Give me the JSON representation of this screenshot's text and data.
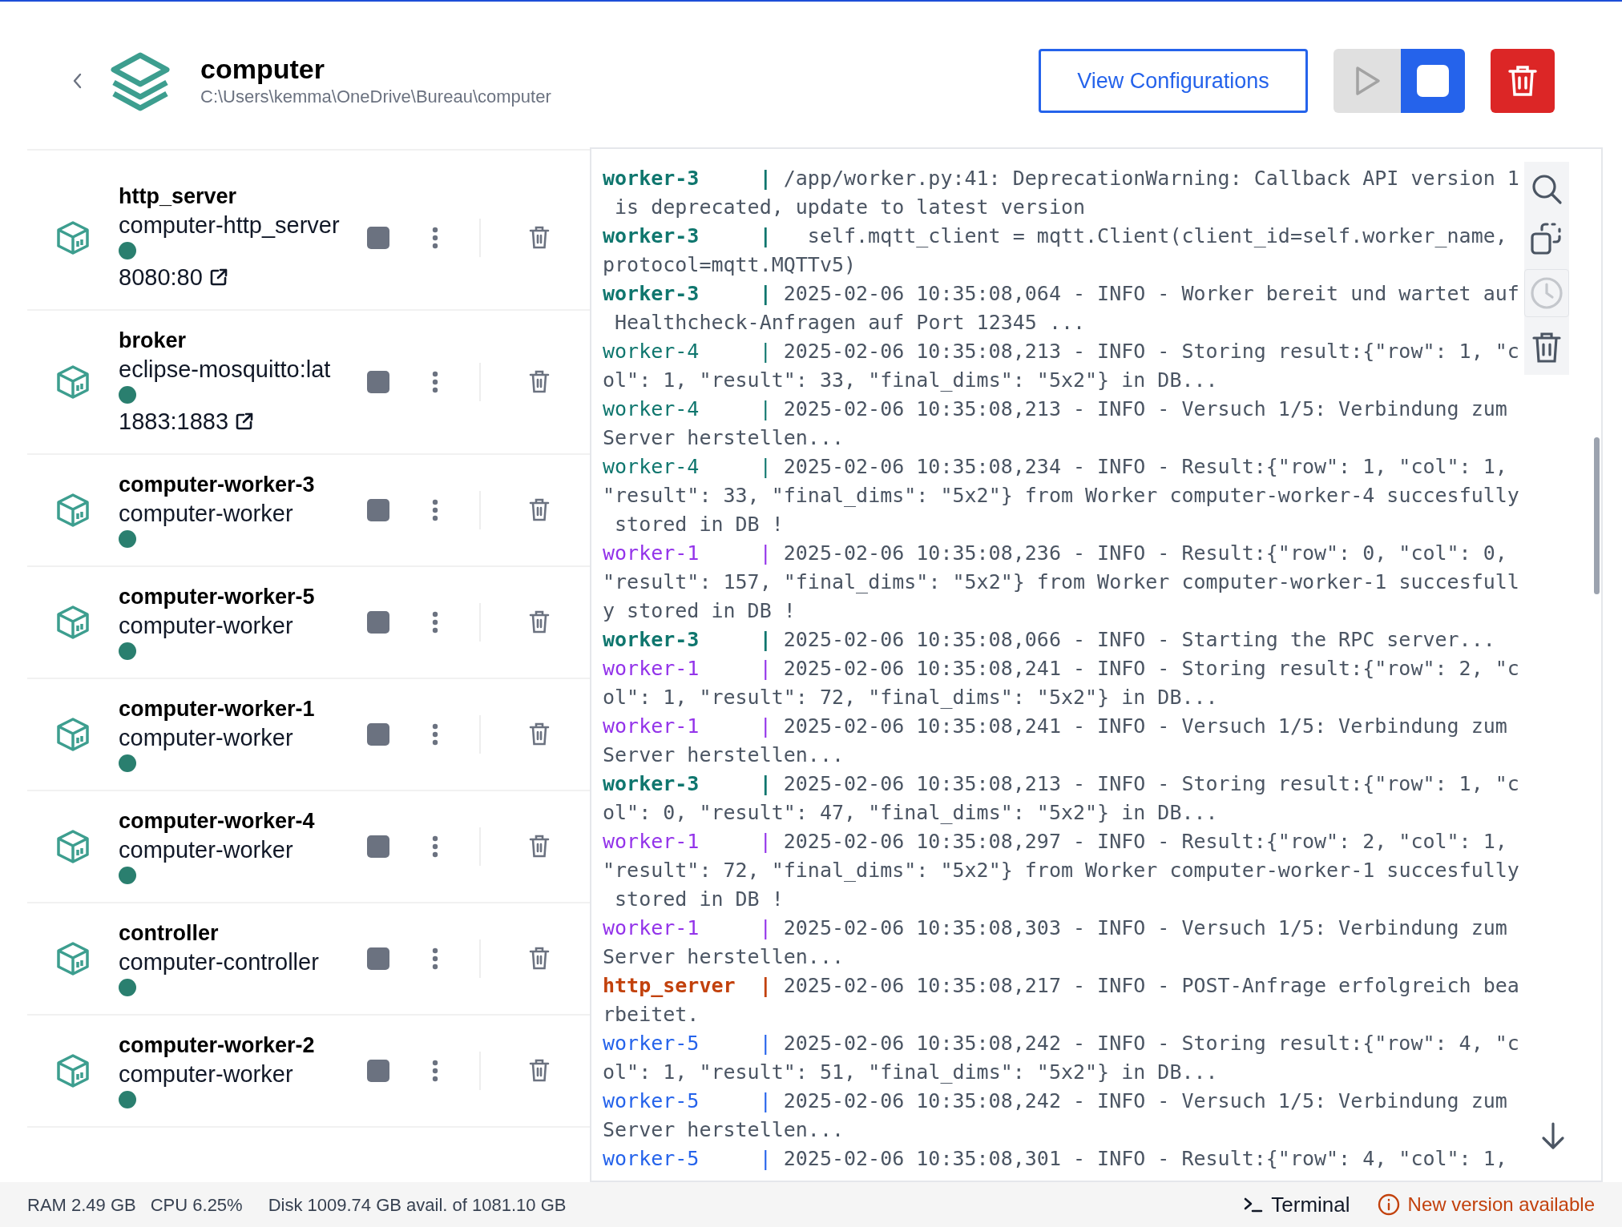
{
  "header": {
    "title": "computer",
    "path": "C:\\Users\\kemma\\OneDrive\\Bureau\\computer",
    "view_button": "View Configurations",
    "play_disabled": true,
    "stop_active": true
  },
  "services": [
    {
      "name": "http_server",
      "image": "computer-http_server",
      "running": true,
      "port": "8080:80"
    },
    {
      "name": "broker",
      "image": "eclipse-mosquitto:lat",
      "running": true,
      "port": "1883:1883"
    },
    {
      "name": "computer-worker-3",
      "image": "computer-worker",
      "running": true
    },
    {
      "name": "computer-worker-5",
      "image": "computer-worker",
      "running": true
    },
    {
      "name": "computer-worker-1",
      "image": "computer-worker",
      "running": true
    },
    {
      "name": "computer-worker-4",
      "image": "computer-worker",
      "running": true
    },
    {
      "name": "controller",
      "image": "computer-controller",
      "running": true
    },
    {
      "name": "computer-worker-2",
      "image": "computer-worker",
      "running": true
    }
  ],
  "log": {
    "clock_disabled": true,
    "entries": [
      {
        "service": "worker-3",
        "color": "#0f766e",
        "bold": true,
        "pipe": "|",
        "lines": [
          "/app/worker.py:41: DeprecationWarning: Callback API version 1",
          " is deprecated, update to latest version"
        ]
      },
      {
        "service": "worker-3",
        "color": "#0f766e",
        "bold": true,
        "pipe": "|",
        "lines": [
          "  self.mqtt_client = mqtt.Client(client_id=self.worker_name,",
          "protocol=mqtt.MQTTv5)"
        ]
      },
      {
        "service": "worker-3",
        "color": "#0f766e",
        "bold": true,
        "pipe": "|",
        "lines": [
          "2025-02-06 10:35:08,064 - INFO - Worker bereit und wartet auf",
          " Healthcheck-Anfragen auf Port 12345 ..."
        ]
      },
      {
        "service": "worker-4",
        "color": "#0f766e",
        "bold": false,
        "pipe": "|",
        "lines": [
          "2025-02-06 10:35:08,213 - INFO - Storing result:{\"row\": 1, \"c",
          "ol\": 1, \"result\": 33, \"final_dims\": \"5x2\"} in DB..."
        ]
      },
      {
        "service": "worker-4",
        "color": "#0f766e",
        "bold": false,
        "pipe": "|",
        "lines": [
          "2025-02-06 10:35:08,213 - INFO - Versuch 1/5: Verbindung zum",
          "Server herstellen..."
        ]
      },
      {
        "service": "worker-4",
        "color": "#0f766e",
        "bold": false,
        "pipe": "|",
        "lines": [
          "2025-02-06 10:35:08,234 - INFO - Result:{\"row\": 1, \"col\": 1,",
          "\"result\": 33, \"final_dims\": \"5x2\"} from Worker computer-worker-4 succesfully",
          " stored in DB !"
        ]
      },
      {
        "service": "worker-1",
        "color": "#9333ea",
        "bold": false,
        "pipe": "|",
        "lines": [
          "2025-02-06 10:35:08,236 - INFO - Result:{\"row\": 0, \"col\": 0,",
          "\"result\": 157, \"final_dims\": \"5x2\"} from Worker computer-worker-1 succesfull",
          "y stored in DB !"
        ]
      },
      {
        "service": "worker-3",
        "color": "#0f766e",
        "bold": true,
        "pipe": "|",
        "lines": [
          "2025-02-06 10:35:08,066 - INFO - Starting the RPC server..."
        ]
      },
      {
        "service": "worker-1",
        "color": "#9333ea",
        "bold": false,
        "pipe": "|",
        "lines": [
          "2025-02-06 10:35:08,241 - INFO - Storing result:{\"row\": 2, \"c",
          "ol\": 1, \"result\": 72, \"final_dims\": \"5x2\"} in DB..."
        ]
      },
      {
        "service": "worker-1",
        "color": "#9333ea",
        "bold": false,
        "pipe": "|",
        "lines": [
          "2025-02-06 10:35:08,241 - INFO - Versuch 1/5: Verbindung zum",
          "Server herstellen..."
        ]
      },
      {
        "service": "worker-3",
        "color": "#0f766e",
        "bold": true,
        "pipe": "|",
        "lines": [
          "2025-02-06 10:35:08,213 - INFO - Storing result:{\"row\": 1, \"c",
          "ol\": 0, \"result\": 47, \"final_dims\": \"5x2\"} in DB..."
        ]
      },
      {
        "service": "worker-1",
        "color": "#9333ea",
        "bold": false,
        "pipe": "|",
        "lines": [
          "2025-02-06 10:35:08,297 - INFO - Result:{\"row\": 2, \"col\": 1,",
          "\"result\": 72, \"final_dims\": \"5x2\"} from Worker computer-worker-1 succesfully",
          " stored in DB !"
        ]
      },
      {
        "service": "worker-1",
        "color": "#9333ea",
        "bold": false,
        "pipe": "|",
        "lines": [
          "2025-02-06 10:35:08,303 - INFO - Versuch 1/5: Verbindung zum",
          "Server herstellen..."
        ]
      },
      {
        "service": "http_server",
        "color": "#c2410c",
        "bold": true,
        "pipe": "|",
        "lines": [
          "2025-02-06 10:35:08,217 - INFO - POST-Anfrage erfolgreich bea",
          "rbeitet."
        ]
      },
      {
        "service": "worker-5",
        "color": "#2563eb",
        "bold": false,
        "pipe": "|",
        "lines": [
          "2025-02-06 10:35:08,242 - INFO - Storing result:{\"row\": 4, \"c",
          "ol\": 1, \"result\": 51, \"final_dims\": \"5x2\"} in DB..."
        ]
      },
      {
        "service": "worker-5",
        "color": "#2563eb",
        "bold": false,
        "pipe": "|",
        "lines": [
          "2025-02-06 10:35:08,242 - INFO - Versuch 1/5: Verbindung zum",
          "Server herstellen..."
        ]
      },
      {
        "service": "worker-5",
        "color": "#2563eb",
        "bold": false,
        "pipe": "|",
        "lines": [
          "2025-02-06 10:35:08,301 - INFO - Result:{\"row\": 4, \"col\": 1,"
        ]
      }
    ]
  },
  "status_bar": {
    "ram": "RAM 2.49 GB",
    "cpu": "CPU 6.25%",
    "disk": "Disk 1009.74 GB avail. of 1081.10 GB",
    "terminal": "Terminal",
    "update": "New version available"
  }
}
